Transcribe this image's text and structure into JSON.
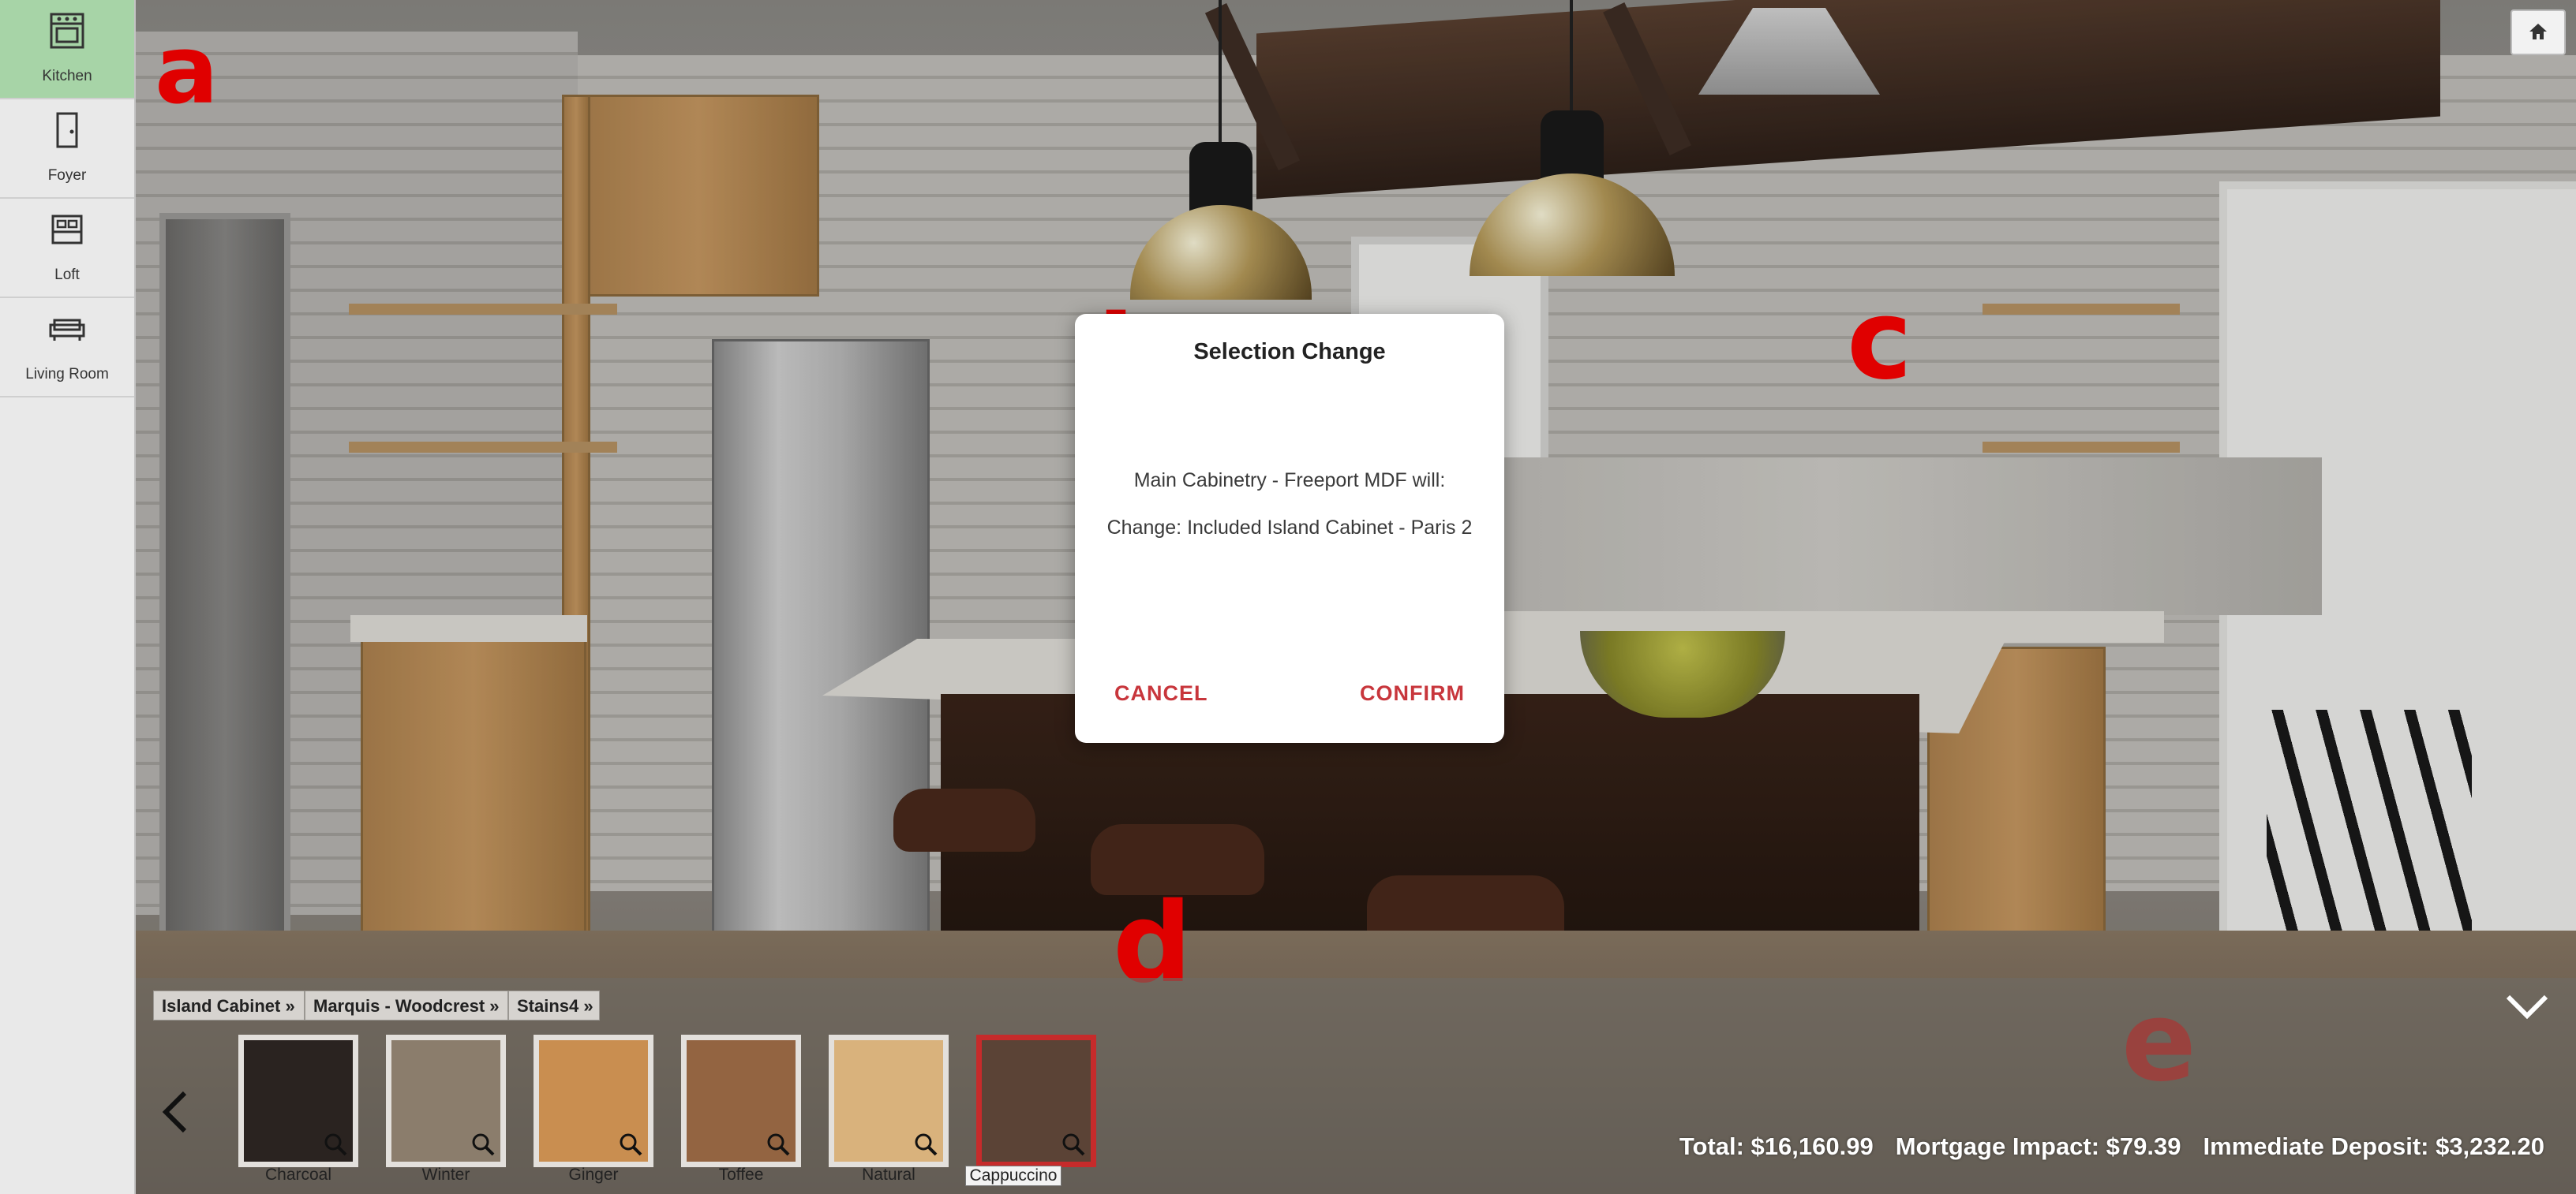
{
  "sidebar": {
    "items": [
      {
        "label": "Kitchen",
        "icon": "oven-icon",
        "active": true
      },
      {
        "label": "Foyer",
        "icon": "door-icon",
        "active": false
      },
      {
        "label": "Loft",
        "icon": "bed-icon",
        "active": false
      },
      {
        "label": "Living Room",
        "icon": "sofa-icon",
        "active": false
      }
    ]
  },
  "header": {
    "home_icon": "home-icon"
  },
  "annotations": {
    "a": "a",
    "b": "b",
    "c": "c",
    "d": "d",
    "e": "e"
  },
  "dialog": {
    "title": "Selection Change",
    "message": "Main Cabinetry - Freeport MDF will:",
    "change": "Change: Included Island Cabinet - Paris 2",
    "cancel_label": "CANCEL",
    "confirm_label": "CONFIRM"
  },
  "breadcrumb": [
    "Island Cabinet",
    "Marquis - Woodcrest",
    "Stains4"
  ],
  "swatches": [
    {
      "label": "Charcoal",
      "color": "#2a2320",
      "selected": false
    },
    {
      "label": "Winter",
      "color": "#8b7d6c",
      "selected": false
    },
    {
      "label": "Ginger",
      "color": "#c98e50",
      "selected": false
    },
    {
      "label": "Toffee",
      "color": "#936441",
      "selected": false
    },
    {
      "label": "Natural",
      "color": "#d9b27c",
      "selected": false
    },
    {
      "label": "Cappuccino",
      "color": "#5b4336",
      "selected": true
    }
  ],
  "totals": {
    "total": "Total: $16,160.99",
    "mortgage": "Mortgage Impact: $79.39",
    "deposit": "Immediate Deposit: $3,232.20"
  },
  "colors": {
    "accent": "#c8363c",
    "sidebar_active": "#a7d4a7"
  }
}
